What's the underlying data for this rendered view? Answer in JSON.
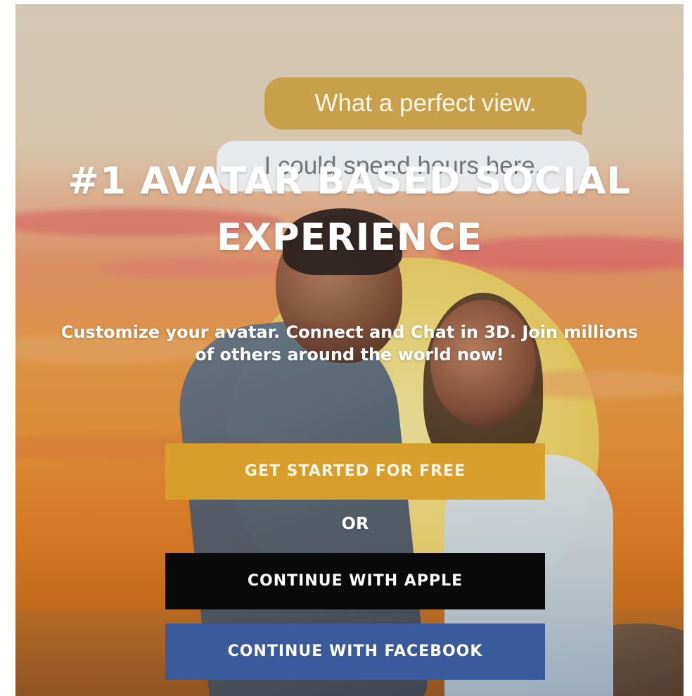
{
  "chat": {
    "bubble_1": "What a perfect view.",
    "bubble_2": "I could spend hours here."
  },
  "hero": {
    "title": "#1 AVATAR BASED SOCIAL EXPERIENCE",
    "subtitle": "Customize your avatar. Connect and Chat in 3D. Join millions of others around the world now!"
  },
  "actions": {
    "get_started_label": "GET STARTED FOR FREE",
    "separator": "OR",
    "apple_label": "CONTINUE WITH APPLE",
    "facebook_label": "CONTINUE WITH FACEBOOK"
  },
  "colors": {
    "get_started_bg": "#d89e2c",
    "apple_bg": "#0a0a0a",
    "facebook_bg": "#3a5a9b",
    "chat_gold": "#c9a04a"
  }
}
